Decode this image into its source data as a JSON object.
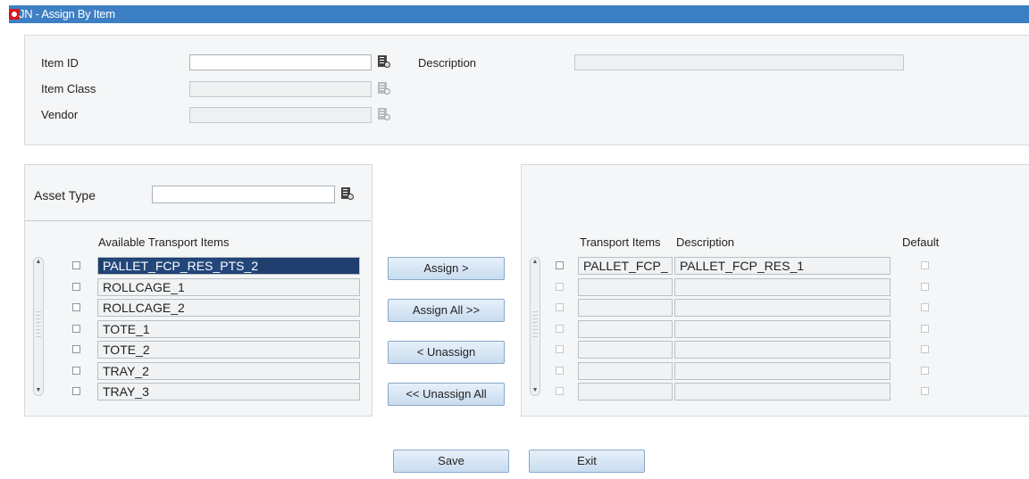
{
  "window": {
    "title": "JN - Assign By Item"
  },
  "item_panel": {
    "item_id_label": "Item ID",
    "item_class_label": "Item Class",
    "vendor_label": "Vendor",
    "description_label": "Description",
    "item_id_value": "",
    "item_class_value": "",
    "vendor_value": "",
    "description_value": ""
  },
  "left_panel": {
    "asset_type_label": "Asset Type",
    "asset_type_value": "",
    "header": "Available Transport Items",
    "items": [
      "PALLET_FCP_RES_PTS_2",
      "ROLLCAGE_1",
      "ROLLCAGE_2",
      "TOTE_1",
      "TOTE_2",
      "TRAY_2",
      "TRAY_3"
    ]
  },
  "buttons": {
    "assign": "Assign >",
    "assign_all": "Assign All >>",
    "unassign": "< Unassign",
    "unassign_all": "<< Unassign All",
    "save": "Save",
    "exit": "Exit"
  },
  "right_panel": {
    "col_transport_items": "Transport Items",
    "col_description": "Description",
    "col_default": "Default",
    "rows": [
      {
        "item": "PALLET_FCP_",
        "description": "PALLET_FCP_RES_1"
      },
      {
        "item": "",
        "description": ""
      },
      {
        "item": "",
        "description": ""
      },
      {
        "item": "",
        "description": ""
      },
      {
        "item": "",
        "description": ""
      },
      {
        "item": "",
        "description": ""
      },
      {
        "item": "",
        "description": ""
      }
    ]
  },
  "icons": {
    "lov": "lov-search-icon",
    "logo": "oracle-logo-icon"
  }
}
